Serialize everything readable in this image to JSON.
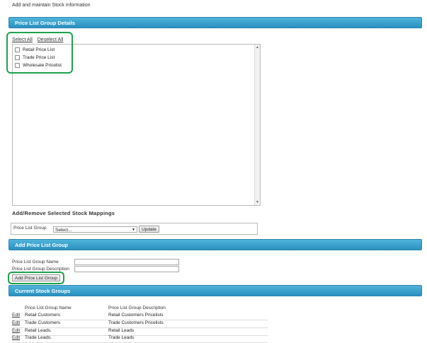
{
  "page": {
    "subtitle": "Add and maintain Stock information"
  },
  "sections": {
    "details": "Price List Group Details",
    "add": "Add Price List Group",
    "current": "Current Stock Groups"
  },
  "selection": {
    "select_all": "Select All",
    "deselect_all": "Deselect All",
    "items": [
      {
        "label": "Retail Price List",
        "checked": false
      },
      {
        "label": "Trade Price List",
        "checked": false
      },
      {
        "label": "Wholesale Pricelist",
        "checked": false
      }
    ]
  },
  "mapping": {
    "title": "Add/Remove Selected Stock Mappings",
    "label": "Price List Group",
    "select_value": "Select...",
    "update_label": "Update"
  },
  "add_form": {
    "name_label": "Price List Group Name",
    "description_label": "Price List Group Description",
    "name_value": "",
    "description_value": "",
    "submit_label": "Add Price List Group"
  },
  "groups_table": {
    "headers": [
      "Price List Group Name",
      "Price List Group Description"
    ],
    "edit_label": "Edit",
    "rows": [
      [
        "Retail Customers",
        "Retail Customers Pricelists"
      ],
      [
        "Trade Customers",
        "Trade Customers Pricelists"
      ],
      [
        "Retail Leads.",
        "Retail Leads"
      ],
      [
        "Trade Leads.",
        "Trade Leads"
      ]
    ]
  },
  "colors": {
    "section_bar": "#2a90bf",
    "highlight": "#1aa34a"
  }
}
